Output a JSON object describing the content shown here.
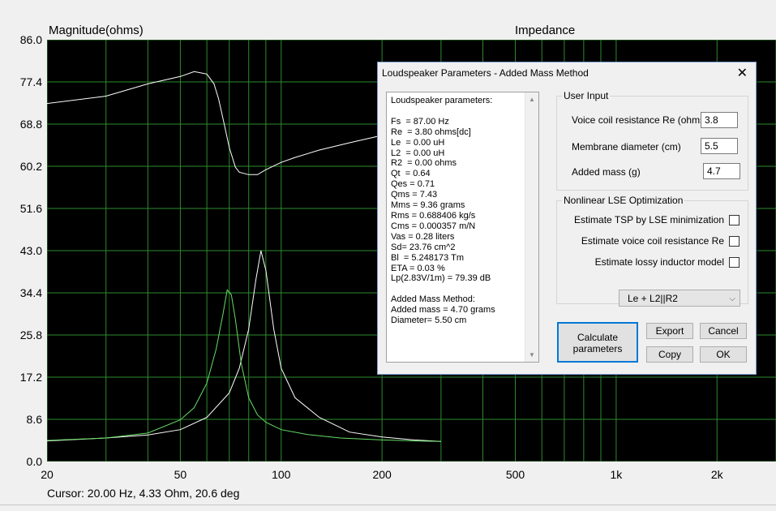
{
  "header": {
    "ylabel": "Magnitude(ohms)",
    "title": "Impedance"
  },
  "status": {
    "cursor": "Cursor: 20.00 Hz, 4.33 Ohm, 20.6 deg"
  },
  "chart_data": {
    "type": "line",
    "title": "Impedance",
    "ylabel": "Magnitude(ohms)",
    "xscale": "log",
    "xlim": [
      20,
      3000
    ],
    "ylim": [
      0,
      86
    ],
    "yticks": [
      "86.0",
      "77.4",
      "68.8",
      "60.2",
      "51.6",
      "43.0",
      "34.4",
      "25.8",
      "17.2",
      "8.6",
      "0.0"
    ],
    "xticks": [
      "20",
      "50",
      "100",
      "200",
      "500",
      "1k",
      "2k"
    ],
    "grid": true,
    "series": [
      {
        "color": "#ffffff",
        "x": [
          20,
          30,
          40,
          50,
          55,
          60,
          63,
          65,
          67,
          70,
          73,
          75,
          80,
          85,
          90,
          100,
          110,
          130,
          160,
          200,
          250,
          300
        ],
        "y": [
          73,
          74.5,
          77,
          78.5,
          79.5,
          79,
          77,
          74,
          70,
          64,
          60,
          59,
          58.5,
          58.5,
          59.5,
          61,
          62,
          63.5,
          65,
          66.5,
          68.5,
          70
        ]
      },
      {
        "color": "#ffffff",
        "x": [
          20,
          30,
          40,
          50,
          60,
          70,
          75,
          80,
          84,
          87,
          90,
          95,
          100,
          110,
          130,
          160,
          200,
          250,
          300
        ],
        "y": [
          4.2,
          4.8,
          5.4,
          6.5,
          9,
          14,
          19,
          27,
          37,
          43,
          39,
          27,
          19,
          13,
          9,
          6,
          5,
          4.4,
          4.1
        ]
      },
      {
        "color": "#66dd66",
        "x": [
          20,
          30,
          40,
          50,
          55,
          60,
          64,
          67,
          69,
          71,
          73,
          76,
          80,
          85,
          90,
          100,
          120,
          150,
          200,
          250,
          300
        ],
        "y": [
          4.3,
          4.8,
          5.8,
          8.5,
          11,
          16,
          23,
          30,
          35,
          34,
          29,
          20,
          13,
          9.5,
          8,
          6.5,
          5.5,
          4.8,
          4.4,
          4.2,
          4.1
        ]
      }
    ]
  },
  "dialog": {
    "title": "Loudspeaker Parameters - Added Mass Method",
    "params_text": "Loudspeaker parameters:\n\nFs  = 87.00 Hz\nRe  = 3.80 ohms[dc]\nLe  = 0.00 uH\nL2  = 0.00 uH\nR2  = 0.00 ohms\nQt  = 0.64\nQes = 0.71\nQms = 7.43\nMms = 9.36 grams\nRms = 0.688406 kg/s\nCms = 0.000357 m/N\nVas = 0.28 liters\nSd= 23.76 cm^2\nBl  = 5.248173 Tm\nETA = 0.03 %\nLp(2.83V/1m) = 79.39 dB\n\nAdded Mass Method:\nAdded mass = 4.70 grams\nDiameter= 5.50 cm",
    "user_input": {
      "title": "User Input",
      "re_label": "Voice coil resistance Re (ohms)",
      "re_value": "3.8",
      "diam_label": "Membrane diameter (cm)",
      "diam_value": "5.5",
      "mass_label": "Added mass (g)",
      "mass_value": "4.7"
    },
    "lse": {
      "title": "Nonlinear LSE Optimization",
      "opt1": "Estimate TSP by LSE minimization",
      "opt2": "Estimate voice coil resistance Re",
      "opt3": "Estimate lossy inductor model",
      "model": "Le + L2||R2"
    },
    "buttons": {
      "calculate": "Calculate parameters",
      "export": "Export",
      "cancel": "Cancel",
      "copy": "Copy",
      "ok": "OK"
    }
  }
}
